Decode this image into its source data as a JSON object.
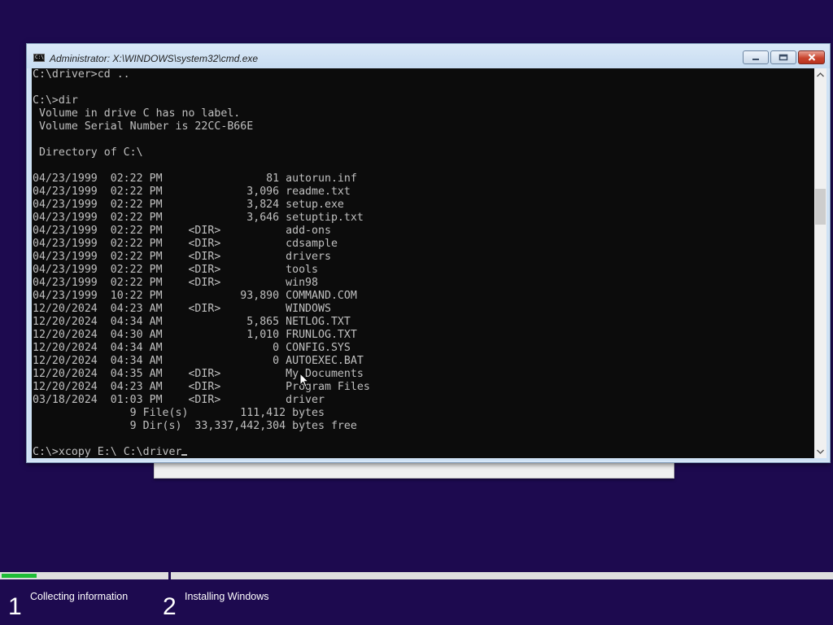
{
  "window": {
    "title": "Administrator: X:\\WINDOWS\\system32\\cmd.exe",
    "icon": "cmd-prompt-icon",
    "buttons": {
      "minimize": "minimize-icon",
      "maximize": "maximize-icon",
      "close": "close-icon"
    }
  },
  "console": {
    "lines": [
      "C:\\driver>cd ..",
      "",
      "C:\\>dir",
      " Volume in drive C has no label.",
      " Volume Serial Number is 22CC-B66E",
      "",
      " Directory of C:\\",
      "",
      "04/23/1999  02:22 PM                81 autorun.inf",
      "04/23/1999  02:22 PM             3,096 readme.txt",
      "04/23/1999  02:22 PM             3,824 setup.exe",
      "04/23/1999  02:22 PM             3,646 setuptip.txt",
      "04/23/1999  02:22 PM    <DIR>          add-ons",
      "04/23/1999  02:22 PM    <DIR>          cdsample",
      "04/23/1999  02:22 PM    <DIR>          drivers",
      "04/23/1999  02:22 PM    <DIR>          tools",
      "04/23/1999  02:22 PM    <DIR>          win98",
      "04/23/1999  10:22 PM            93,890 COMMAND.COM",
      "12/20/2024  04:23 AM    <DIR>          WINDOWS",
      "12/20/2024  04:34 AM             5,865 NETLOG.TXT",
      "12/20/2024  04:30 AM             1,010 FRUNLOG.TXT",
      "12/20/2024  04:34 AM                 0 CONFIG.SYS",
      "12/20/2024  04:34 AM                 0 AUTOEXEC.BAT",
      "12/20/2024  04:35 AM    <DIR>          My Documents",
      "12/20/2024  04:23 AM    <DIR>          Program Files",
      "03/18/2024  01:03 PM    <DIR>          driver",
      "               9 File(s)        111,412 bytes",
      "               9 Dir(s)  33,337,442,304 bytes free",
      ""
    ],
    "prompt": "C:\\>",
    "command_input": "xcopy E:\\ C:\\driver"
  },
  "setup": {
    "steps": [
      {
        "number": "1",
        "label": "Collecting information"
      },
      {
        "number": "2",
        "label": "Installing Windows"
      }
    ],
    "progress_step1": 0.21,
    "progress_color": "#1fbd37",
    "background_color": "#1d0a4f"
  }
}
